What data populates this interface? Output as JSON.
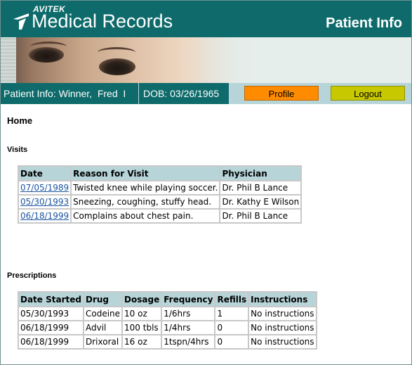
{
  "header": {
    "brand_small": "AVITEK",
    "brand_title": "Medical Records",
    "page_heading": "Patient Info"
  },
  "infobar": {
    "patient": "Patient Info: Winner,  Fred  I",
    "dob": "DOB: 03/26/1965",
    "profile_label": "Profile",
    "logout_label": "Logout"
  },
  "colors": {
    "header_teal": "#0f6b6b",
    "table_header_bg": "#b7d5d9",
    "profile_button": "#ff8c00",
    "logout_button": "#c8c800",
    "link": "#1b55a0"
  },
  "breadcrumb": "Home",
  "visits": {
    "title": "Visits",
    "columns": [
      "Date",
      "Reason for Visit",
      "Physician"
    ],
    "rows": [
      [
        "07/05/1989",
        "Twisted knee while playing soccer.",
        "Dr. Phil B Lance"
      ],
      [
        "05/30/1993",
        "Sneezing, coughing, stuffy head.",
        "Dr. Kathy E Wilson"
      ],
      [
        "06/18/1999",
        "Complains about chest pain.",
        "Dr. Phil B Lance"
      ]
    ]
  },
  "prescriptions": {
    "title": "Prescriptions",
    "columns": [
      "Date Started",
      "Drug",
      "Dosage",
      "Frequency",
      "Refills",
      "Instructions"
    ],
    "rows": [
      [
        "05/30/1993",
        "Codeine",
        "10 oz",
        "1/6hrs",
        "1",
        "No instructions"
      ],
      [
        "06/18/1999",
        "Advil",
        "100 tbls",
        "1/4hrs",
        "0",
        "No instructions"
      ],
      [
        "06/18/1999",
        "Drixoral",
        "16 oz",
        "1tspn/4hrs",
        "0",
        "No instructions"
      ]
    ]
  }
}
